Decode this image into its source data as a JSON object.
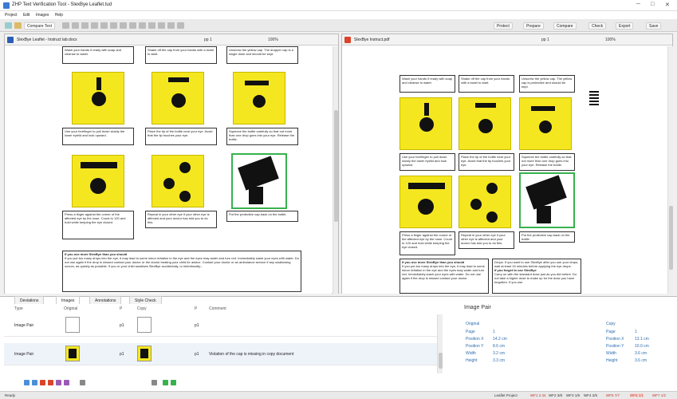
{
  "app": {
    "title": "ZHP Text Verification Tool - SlexBye Leaflet.tud"
  },
  "menu": [
    "Project",
    "Edit",
    "Images",
    "Help"
  ],
  "toolbar": {
    "compare_label": "Compare Text",
    "right_buttons": [
      "Protect",
      "Prepare",
      "Compare",
      "Check",
      "Export",
      "Save"
    ]
  },
  "left_pane": {
    "file_name": "SlexBye Leaflet - Instruct lab.docx",
    "page_nav": "pp 1",
    "zoom": "100%"
  },
  "right_pane": {
    "file_name": "SlexBye Instruct.pdf",
    "page_nav": "pp 1",
    "zoom": "100%"
  },
  "left_doc": {
    "row1": [
      "Wash your hands if ready with soap and cleanse to water.",
      "Shake off the cap from your hands with a towel to start.",
      "Unscrew the yellow cap. The dropper cap is a single dose and should be kept."
    ],
    "row2": [
      "Use your forefinger to pull down slowly the lower eyelid and look upward.",
      "Place the tip of the bottle near your eye. Avoid that the tip touches your eye.",
      "Squeeze the bottle carefully so that not more than one drop goes into your eye. Release the bottle."
    ],
    "row3": [
      "Press a finger against the corner of the affected eye by the nose. Count to 120 and hold while keeping the eye closed.",
      "Repeat in your other eye if your other eye is affected and your doctor has told you to do this.",
      "Put the protective cap back on the bottle."
    ],
    "warning_title": "If you use more SlexBye than you should",
    "warning_body": "If you put too many drops into the eye, it may lead to some minor irritation in the eye and the eyes may water and turn red. Immediately wash your eyes with water. Do not use again if the drop is missed contact your doctor or the doctor treating your child for advice. Contact your doctor or an ambulance service if any swallowing occurs, as quickly as possible. If you or your child swallows SlexBye accidentally, or intentionally..."
  },
  "right_doc": {
    "row1": [
      "Wash your hands if ready with soap and cleanse to water.",
      "Shake off the cap from your hands with a towel to start.",
      "Unscrew the yellow cap. The yellow cap is protective and should be kept."
    ],
    "row2": [
      "Use your forefinger to pull down slowly the lower eyelid and look upward.",
      "Place the tip of the bottle near your eye. Avoid that the tip touches your eye.",
      "Squeeze the bottle carefully so that not more than one drop goes into your eye. Release the bottle."
    ],
    "row3": [
      "Press a finger against the corner of the affected eye by the nose. Count to 120 and hold while keeping the eye closed.",
      "Repeat in your other eye if your other eye is affected and your doctor has told you to do this.",
      "Put the protective cap back on the bottle."
    ],
    "col1_title": "If you use more SlexBye than you should",
    "col1_body": "If you put too many drops into the eye, it may lead to some minor irritation in the eye and the eyes may water and turn red. Immediately wash your eyes with water. Do not use again if the drop is missed contact your doctor.",
    "col2_top": "Drops. If you want to use SlexBye after you use your drops, wait at least 15 minutes before applying the eye drops.",
    "col2_title": "If you forget to use SlexBye",
    "col2_body": "Carry on with the standard dose just as you did before. Do not take a higher dose to make up for the dose you have forgotten. If you use"
  },
  "bottom": {
    "tabs": [
      "Deviations",
      "Images",
      "Annotations",
      "Style Check"
    ],
    "columns": [
      "Type",
      "Original",
      "P",
      "Copy",
      "P",
      "Comment"
    ],
    "rows": [
      {
        "type": "Image Pair",
        "p1": "p1",
        "p2": "p1",
        "comment": ""
      },
      {
        "type": "Image Pair",
        "p1": "p1",
        "p2": "p1",
        "comment": "Violation of the cap is missing in copy document"
      }
    ],
    "image_pair": {
      "title": "Image Pair",
      "original_label": "Original",
      "copy_label": "Copy",
      "labels": [
        "Page",
        "Position X",
        "Position Y",
        "Width",
        "Height"
      ],
      "original_values": [
        "1",
        "14.2 cm",
        "8.6 cm",
        "3.2 cm",
        "3.3 cm"
      ],
      "copy_values": [
        "1",
        "13.1 cm",
        "10.0 cm",
        "3.6 cm",
        "3.6 cm"
      ]
    }
  },
  "status": {
    "left": "Ready",
    "items": [
      "Leaflet Project",
      "WF1 2.34",
      "WF2 3/8",
      "WF3 1/8",
      "WF4 2/5",
      "WF5 7/7",
      "WF6 1/1",
      "WF7 1/2"
    ]
  },
  "colors": {
    "accent": "#3a7bd5",
    "highlight_green": "#37b24d",
    "illustration_yellow": "#f5e71f",
    "pdf_red": "#d9442a"
  }
}
